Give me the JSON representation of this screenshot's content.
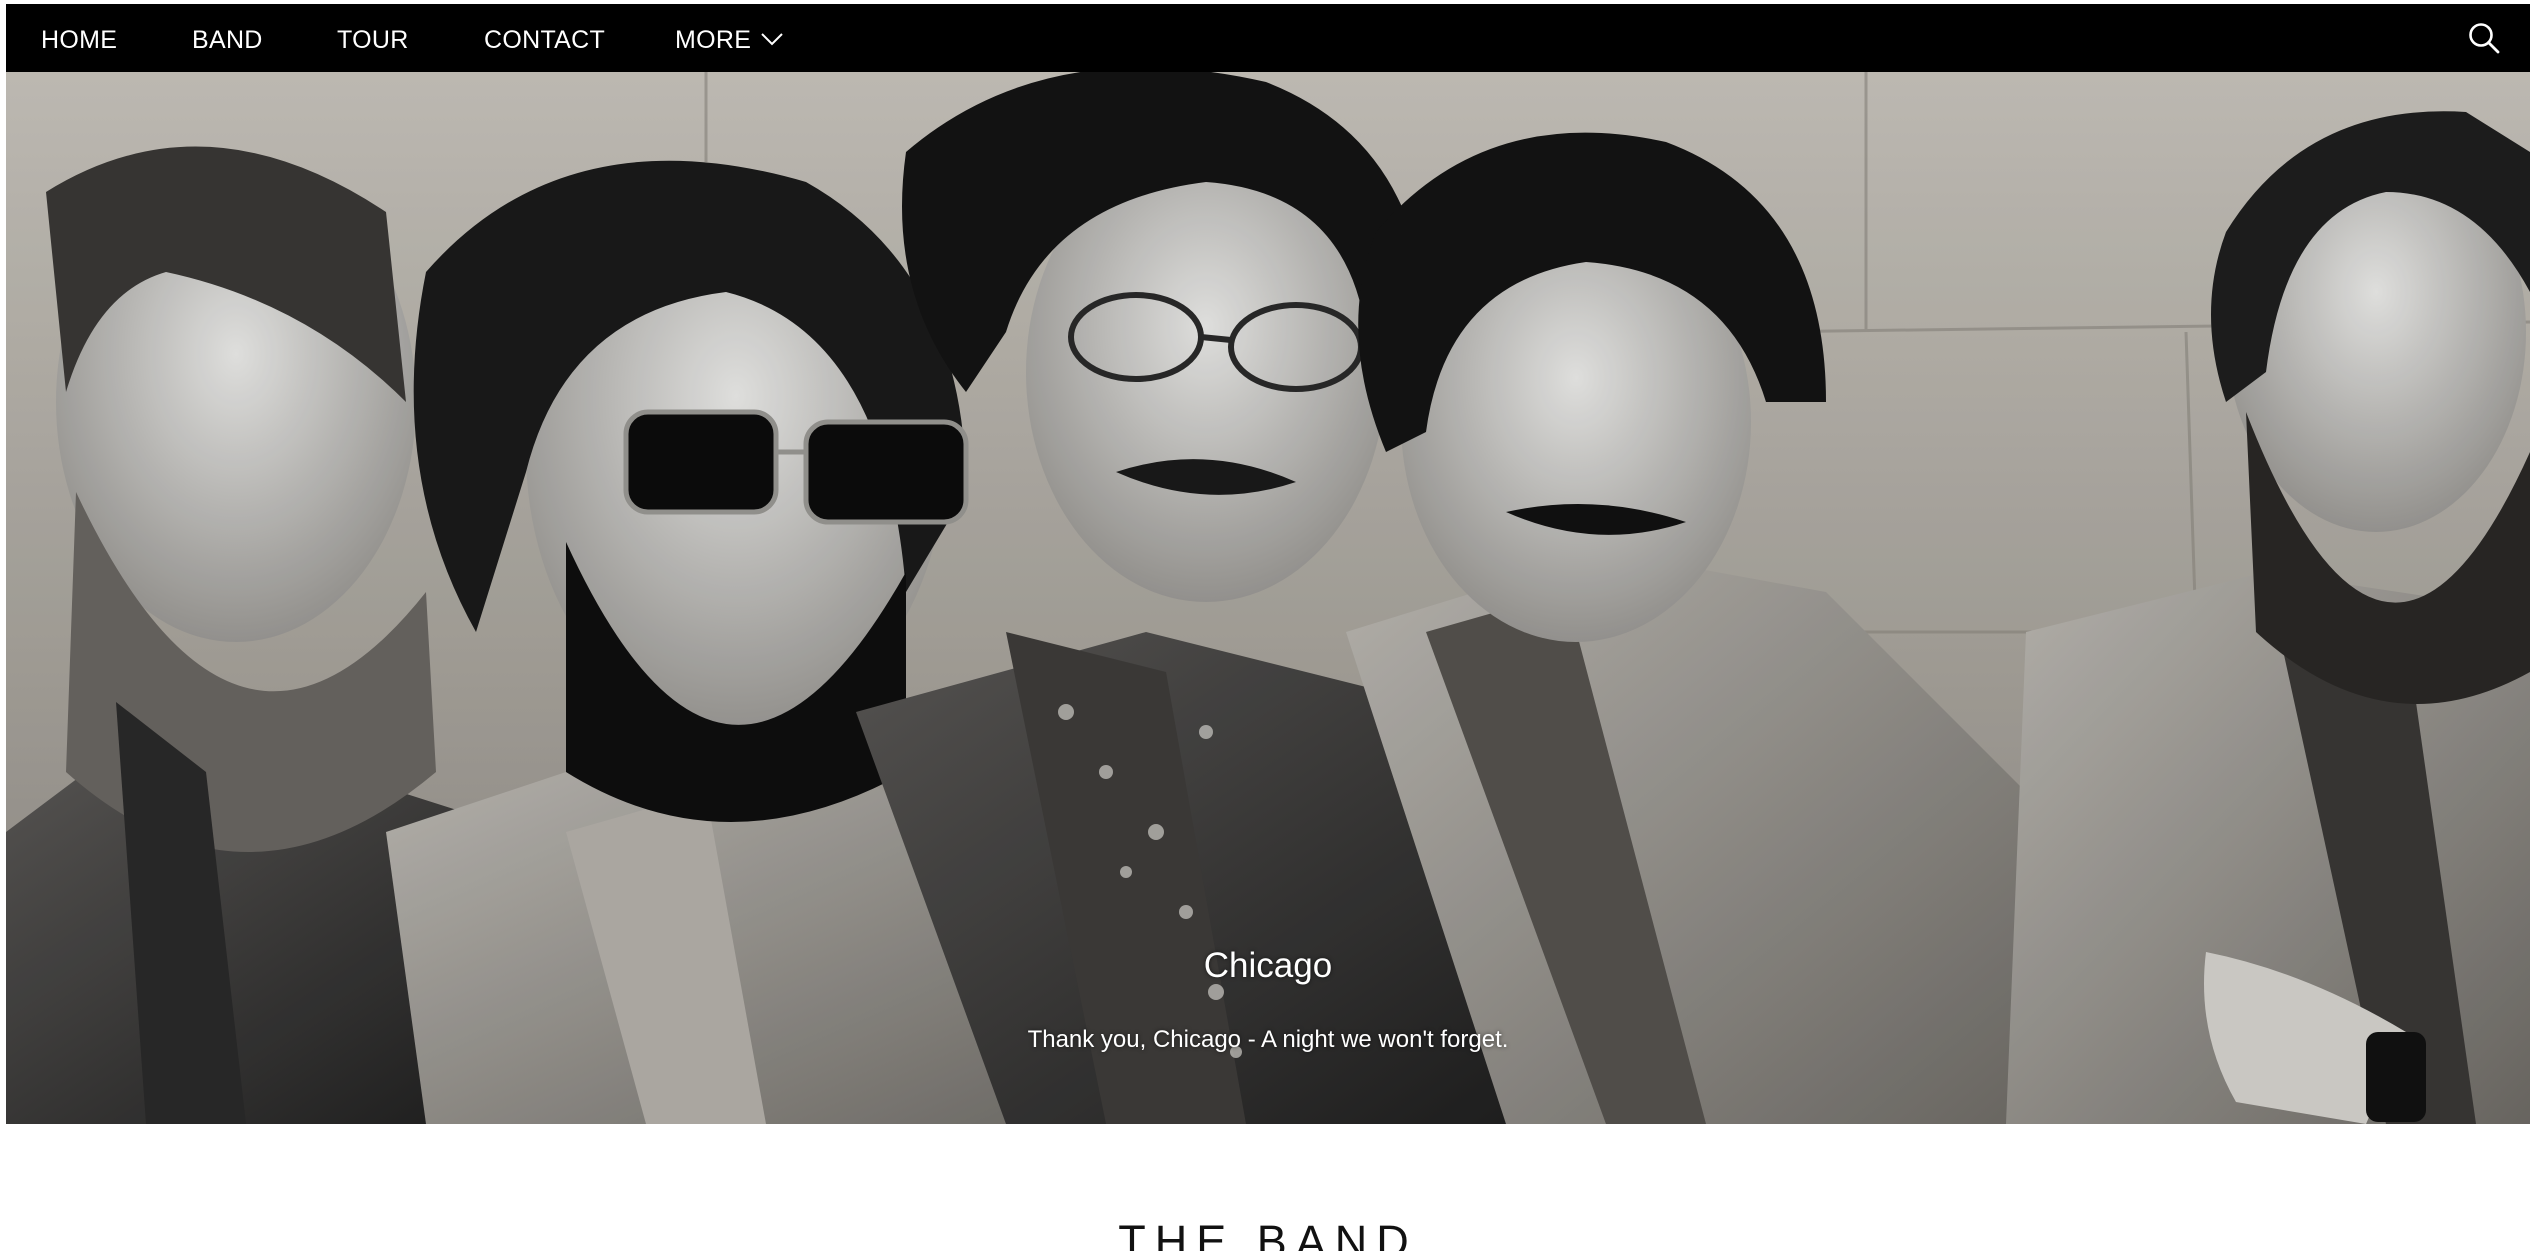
{
  "nav": {
    "items": [
      {
        "label": "HOME"
      },
      {
        "label": "BAND"
      },
      {
        "label": "TOUR"
      },
      {
        "label": "CONTACT"
      }
    ],
    "more_label": "MORE",
    "icons": {
      "more": "chevron-down-icon",
      "search": "search-icon"
    }
  },
  "hero": {
    "image": "black-and-white photo of five bearded/mustached band members against a stone wall",
    "caption_title": "Chicago",
    "caption_text": "Thank you, Chicago - A night we won't forget."
  },
  "section": {
    "title": "THE BAND"
  },
  "colors": {
    "navbar_bg": "#000000",
    "nav_text": "#ffffff",
    "page_bg": "#ffffff"
  }
}
